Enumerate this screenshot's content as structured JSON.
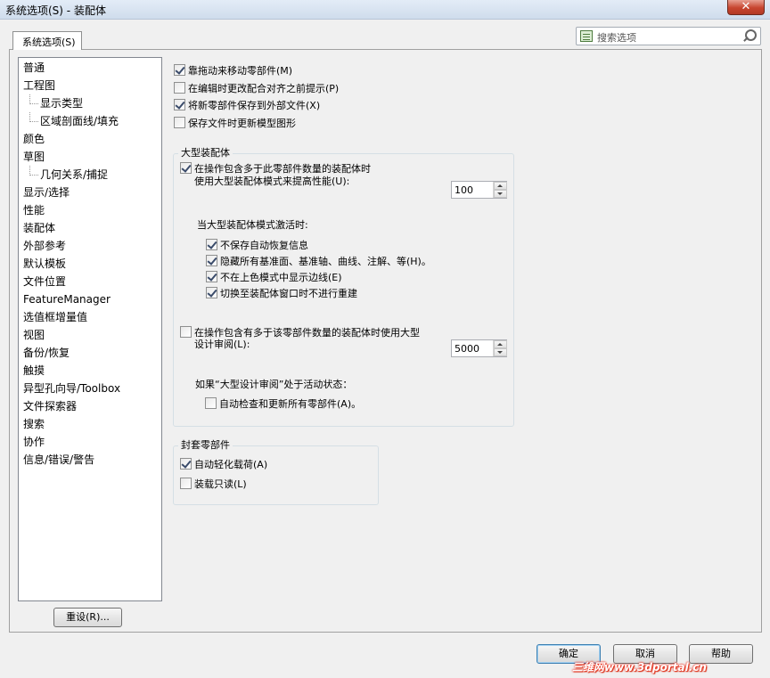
{
  "window": {
    "title": "系统选项(S) - 装配体",
    "close_glyph": "✕"
  },
  "tab": {
    "label": "系统选项(S)"
  },
  "search": {
    "placeholder": "搜索选项"
  },
  "tree": {
    "items": [
      {
        "label": "普通",
        "child": false
      },
      {
        "label": "工程图",
        "child": false
      },
      {
        "label": "显示类型",
        "child": true
      },
      {
        "label": "区域剖面线/填充",
        "child": true
      },
      {
        "label": "颜色",
        "child": false
      },
      {
        "label": "草图",
        "child": false
      },
      {
        "label": "几何关系/捕捉",
        "child": true
      },
      {
        "label": "显示/选择",
        "child": false
      },
      {
        "label": "性能",
        "child": false
      },
      {
        "label": "装配体",
        "child": false
      },
      {
        "label": "外部参考",
        "child": false
      },
      {
        "label": "默认模板",
        "child": false
      },
      {
        "label": "文件位置",
        "child": false
      },
      {
        "label": "FeatureManager",
        "child": false
      },
      {
        "label": "选值框增量值",
        "child": false
      },
      {
        "label": "视图",
        "child": false
      },
      {
        "label": "备份/恢复",
        "child": false
      },
      {
        "label": "触摸",
        "child": false
      },
      {
        "label": "异型孔向导/Toolbox",
        "child": false
      },
      {
        "label": "文件探索器",
        "child": false
      },
      {
        "label": "搜索",
        "child": false
      },
      {
        "label": "协作",
        "child": false
      },
      {
        "label": "信息/错误/警告",
        "child": false
      }
    ],
    "reset_label": "重设(R)..."
  },
  "options": {
    "drag_move": {
      "label": "靠拖动来移动零部件(M)",
      "checked": true
    },
    "prompt_mate": {
      "label": "在编辑时更改配合对齐之前提示(P)",
      "checked": false
    },
    "save_external": {
      "label": "将新零部件保存到外部文件(X)",
      "checked": true
    },
    "update_graphics": {
      "label": "保存文件时更新模型图形",
      "checked": false
    }
  },
  "large_assembly": {
    "title": "大型装配体",
    "use_mode": {
      "label_line1": "在操作包含多于此零部件数量的装配体时",
      "label_line2": "使用大型装配体模式来提高性能(U):",
      "checked": true,
      "value": "100"
    },
    "when_active_label": "当大型装配体模式激活时:",
    "sub_options": [
      {
        "label": "不保存自动恢复信息",
        "checked": true
      },
      {
        "label": "隐藏所有基准面、基准轴、曲线、注解、等(H)。",
        "checked": true
      },
      {
        "label": "不在上色模式中显示边线(E)",
        "checked": true
      },
      {
        "label": "切换至装配体窗口时不进行重建",
        "checked": true
      }
    ],
    "design_review": {
      "label_line1": "在操作包含有多于该零部件数量的装配体时使用大型",
      "label_line2": "设计审阅(L):",
      "checked": false,
      "value": "5000"
    },
    "if_active_label": "如果“大型设计审阅”处于活动状态：",
    "auto_check": {
      "label": "自动检查和更新所有零部件(A)。",
      "checked": false
    }
  },
  "envelope": {
    "title": "封套零部件",
    "auto_lightweight": {
      "label": "自动轻化载荷(A)",
      "checked": true
    },
    "load_readonly": {
      "label": "装载只读(L)",
      "checked": false
    }
  },
  "buttons": {
    "ok": "确定",
    "cancel": "取消",
    "help": "帮助"
  },
  "watermark": "三维网www.3dportal.cn"
}
